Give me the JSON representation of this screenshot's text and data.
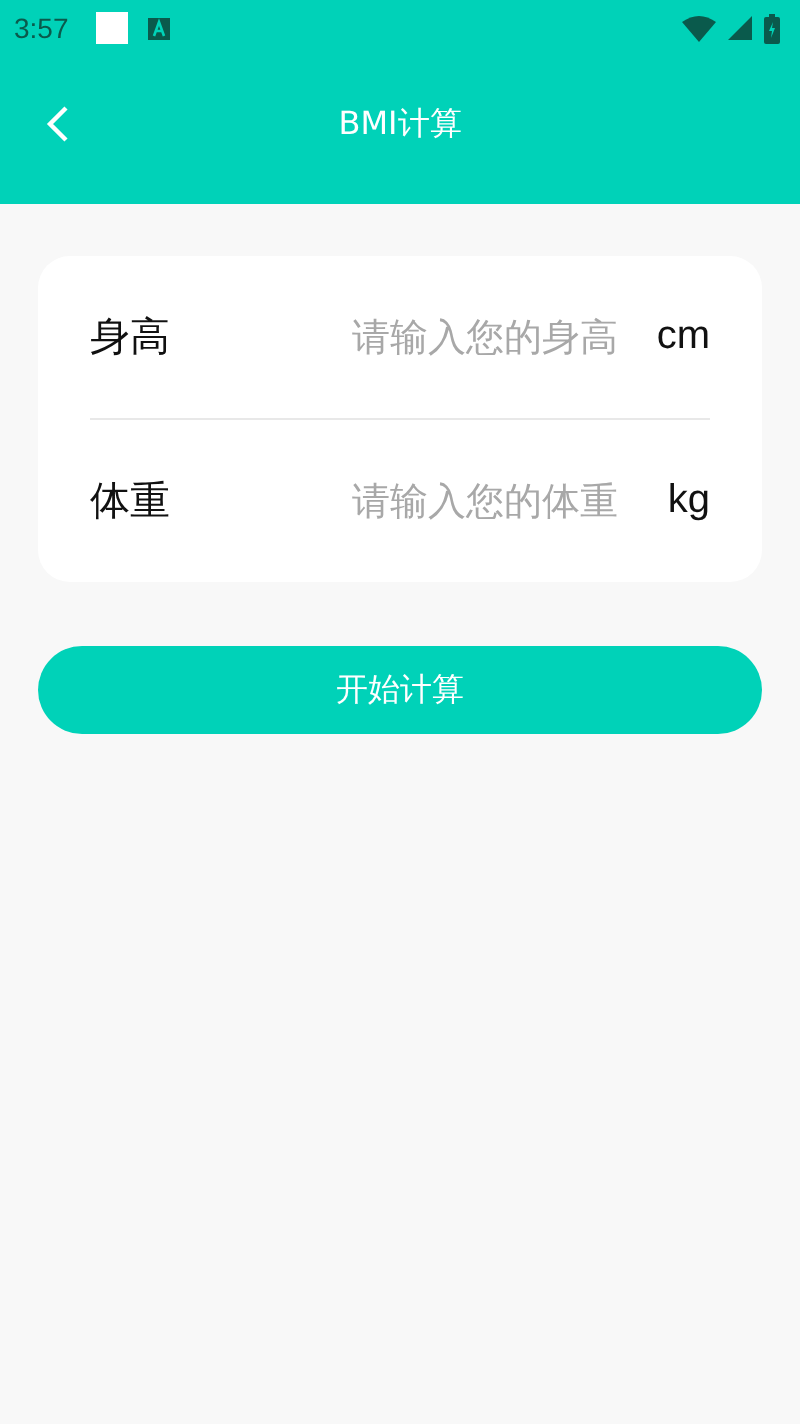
{
  "status_bar": {
    "time": "3:57"
  },
  "header": {
    "title": "BMI计算"
  },
  "fields": [
    {
      "label": "身高",
      "placeholder": "请输入您的身高",
      "unit": "cm"
    },
    {
      "label": "体重",
      "placeholder": "请输入您的体重",
      "unit": "kg"
    }
  ],
  "button": "开始计算"
}
